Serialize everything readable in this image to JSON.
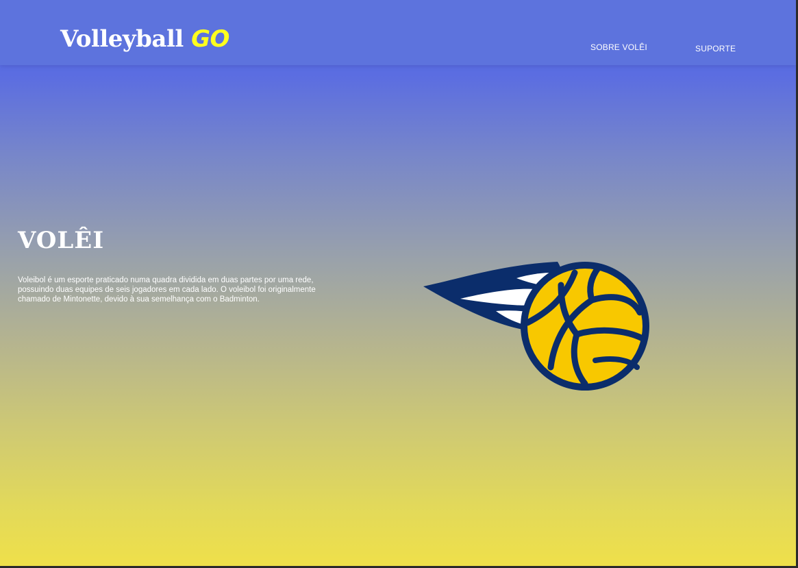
{
  "header": {
    "brand_main": "Volleyball",
    "brand_accent": "GO",
    "nav": [
      {
        "label": "SOBRE VOLÊI"
      },
      {
        "label": "SUPORTE"
      }
    ]
  },
  "hero": {
    "title": "VOLÊI",
    "description": "Voleibol é um esporte praticado numa quadra dividida em duas partes por uma rede,\n possuindo duas equipes de seis jogadores em cada lado. O voleibol foi originalmente\nchamado de Mintonette, devido à sua semelhança com o Badminton.",
    "illustration_icon": "volleyball-icon"
  },
  "colors": {
    "header_bg": "#5d73dd",
    "brand_accent": "#ffff1e",
    "gradient_top": "#5a6ee2",
    "gradient_bottom": "#efe04a",
    "ball_navy": "#0b2d6b",
    "ball_yellow": "#f8c800"
  }
}
